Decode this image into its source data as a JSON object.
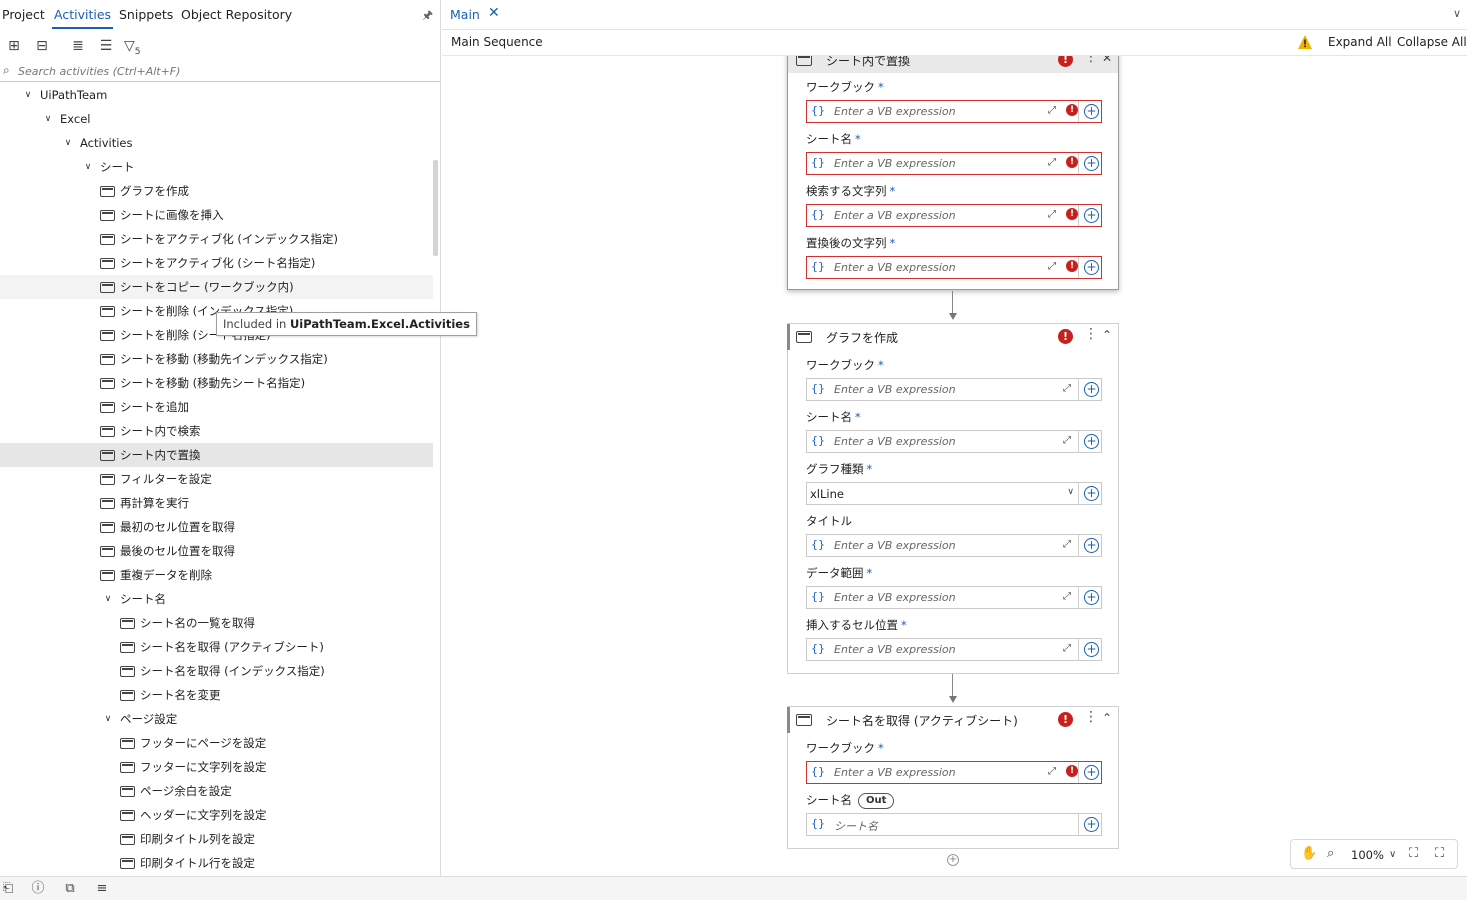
{
  "left_panel": {
    "tabs": [
      {
        "label": "Project"
      },
      {
        "label": "Activities"
      },
      {
        "label": "Snippets"
      },
      {
        "label": "Object Repository"
      }
    ],
    "filter_count": "5",
    "search_placeholder": "Search activities (Ctrl+Alt+F)",
    "tree": [
      {
        "label": "UiPathTeam"
      },
      {
        "label": "Excel"
      },
      {
        "label": "Activities"
      },
      {
        "label": "シート"
      },
      {
        "label": "グラフを作成"
      },
      {
        "label": "シートに画像を挿入"
      },
      {
        "label": "シートをアクティブ化 (インデックス指定)"
      },
      {
        "label": "シートをアクティブ化 (シート名指定)"
      },
      {
        "label": "シートをコピー (ワークブック内)"
      },
      {
        "label": "シートを削除 (インデックス指定)"
      },
      {
        "label": "シートを削除 (シート名指定)"
      },
      {
        "label": "シートを移動 (移動先インデックス指定)"
      },
      {
        "label": "シートを移動 (移動先シート名指定)"
      },
      {
        "label": "シートを追加"
      },
      {
        "label": "シート内で検索"
      },
      {
        "label": "シート内で置換"
      },
      {
        "label": "フィルターを設定"
      },
      {
        "label": "再計算を実行"
      },
      {
        "label": "最初のセル位置を取得"
      },
      {
        "label": "最後のセル位置を取得"
      },
      {
        "label": "重複データを削除"
      },
      {
        "label": "シート名"
      },
      {
        "label": "シート名の一覧を取得"
      },
      {
        "label": "シート名を取得 (アクティブシート)"
      },
      {
        "label": "シート名を取得 (インデックス指定)"
      },
      {
        "label": "シート名を変更"
      },
      {
        "label": "ページ設定"
      },
      {
        "label": "フッターにページを設定"
      },
      {
        "label": "フッターに文字列を設定"
      },
      {
        "label": "ページ余白を設定"
      },
      {
        "label": "ヘッダーに文字列を設定"
      },
      {
        "label": "印刷タイトル列を設定"
      },
      {
        "label": "印刷タイトル行を設定"
      }
    ],
    "tooltip": {
      "prefix": "Included in ",
      "package": "UiPathTeam.Excel.Activities"
    }
  },
  "designer": {
    "tab_label": "Main",
    "breadcrumb": "Main Sequence",
    "expand_all": "Expand All",
    "collapse_all": "Collapse All",
    "vb_placeholder": "Enter a VB expression",
    "zoom": "100%",
    "cards": [
      {
        "title": "シート内で置換",
        "fields": [
          {
            "label": "ワークブック"
          },
          {
            "label": "シート名"
          },
          {
            "label": "検索する文字列"
          },
          {
            "label": "置換後の文字列"
          }
        ]
      },
      {
        "title": "グラフを作成",
        "fields": [
          {
            "label": "ワークブック"
          },
          {
            "label": "シート名"
          },
          {
            "label": "グラフ種類",
            "value": "xlLine"
          },
          {
            "label": "タイトル"
          },
          {
            "label": "データ範囲"
          },
          {
            "label": "挿入するセル位置"
          }
        ]
      },
      {
        "title": "シート名を取得 (アクティブシート)",
        "fields": [
          {
            "label": "ワークブック"
          },
          {
            "label": "シート名",
            "pill": "Out",
            "placeholder": "シート名"
          }
        ]
      }
    ]
  },
  "colors": {
    "accent": "#1a5fb4",
    "error": "#c5221f",
    "warning": "#f2b200"
  }
}
